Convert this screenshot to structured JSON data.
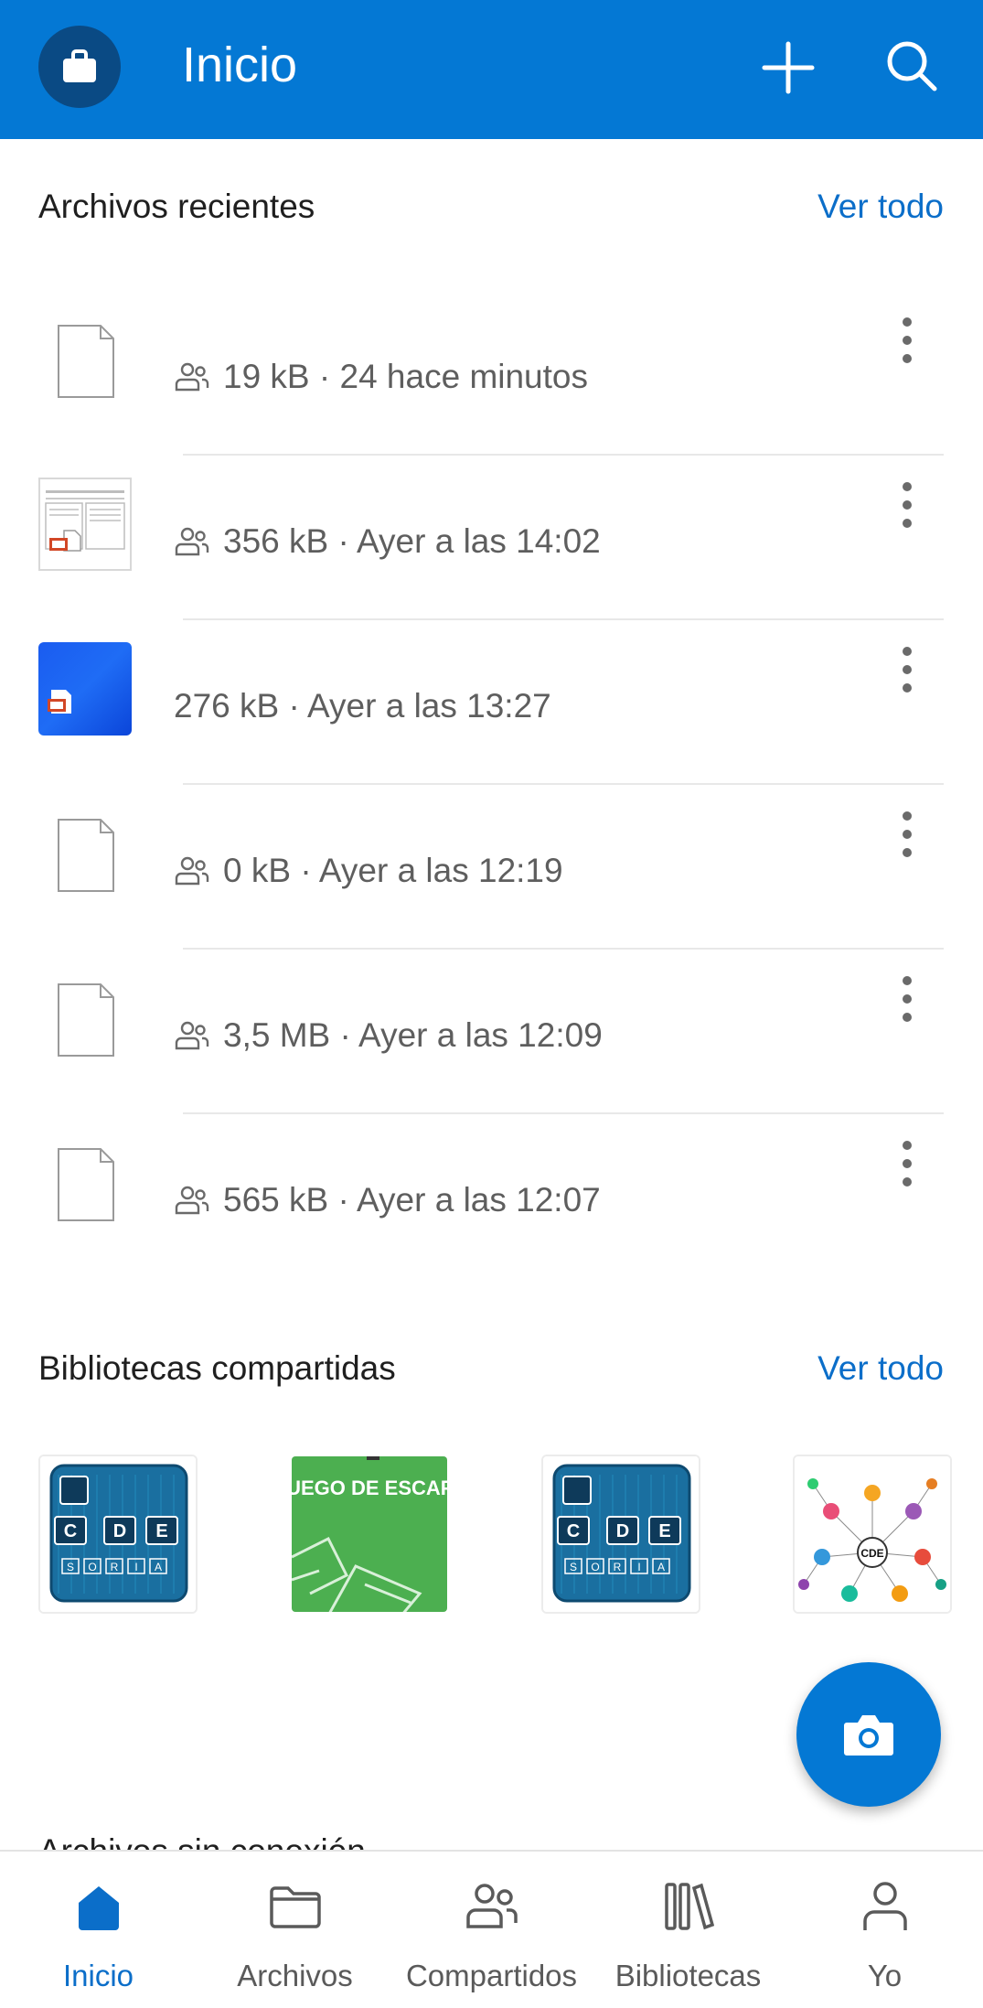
{
  "header": {
    "title": "Inicio",
    "icons": {
      "account": "briefcase-icon",
      "add": "plus-icon",
      "search": "search-icon"
    }
  },
  "recent_files": {
    "title": "Archivos recientes",
    "see_all": "Ver todo",
    "items": [
      {
        "thumbnail": "blank-document",
        "shared": true,
        "size": "19 kB",
        "time": "24 hace minutos",
        "meta": "19 kB · 24 hace minutos"
      },
      {
        "thumbnail": "document-preview",
        "shared": true,
        "size": "356 kB",
        "time": "Ayer a las 14:02",
        "meta": "356 kB · Ayer a las 14:02"
      },
      {
        "thumbnail": "blue-image-preview",
        "shared": false,
        "size": "276 kB",
        "time": "Ayer a las 13:27",
        "meta": "276 kB · Ayer a las 13:27"
      },
      {
        "thumbnail": "blank-document",
        "shared": true,
        "size": "0 kB",
        "time": "Ayer a las 12:19",
        "meta": "0 kB · Ayer a las 12:19"
      },
      {
        "thumbnail": "blank-document",
        "shared": true,
        "size": "3,5 MB",
        "time": "Ayer a las 12:09",
        "meta": "3,5 MB · Ayer a las 12:09"
      },
      {
        "thumbnail": "blank-document",
        "shared": true,
        "size": "565 kB",
        "time": "Ayer a las 12:07",
        "meta": "565 kB · Ayer a las 12:07"
      }
    ]
  },
  "shared_libraries": {
    "title": "Bibliotecas compartidas",
    "see_all": "Ver todo",
    "items": [
      {
        "thumbnail": "cde-soria-logo",
        "logo_text": [
          "C",
          "D",
          "E",
          "S",
          "O",
          "R",
          "I",
          "A"
        ]
      },
      {
        "thumbnail": "escape-game-cover",
        "logo_text": [
          "JUEGO DE ESCAPE"
        ]
      },
      {
        "thumbnail": "cde-soria-logo",
        "logo_text": [
          "C",
          "D",
          "E",
          "S",
          "O",
          "R",
          "I",
          "A"
        ]
      },
      {
        "thumbnail": "network-diagram",
        "logo_text": [
          "CDE"
        ]
      }
    ]
  },
  "offline_section": {
    "title": "Archivos sin conexión"
  },
  "fab": {
    "icon": "camera-icon"
  },
  "bottom_nav": {
    "items": [
      {
        "label": "Inicio",
        "icon": "home-icon",
        "active": true
      },
      {
        "label": "Archivos",
        "icon": "folder-icon",
        "active": false
      },
      {
        "label": "Compartidos",
        "icon": "people-icon",
        "active": false
      },
      {
        "label": "Bibliotecas",
        "icon": "library-icon",
        "active": false
      },
      {
        "label": "Yo",
        "icon": "person-icon",
        "active": false
      }
    ]
  },
  "colors": {
    "brand": "#0478d4",
    "link": "#0b6ec9",
    "avatar_bg": "#0a4a84",
    "text_secondary": "#5e5e5e"
  }
}
